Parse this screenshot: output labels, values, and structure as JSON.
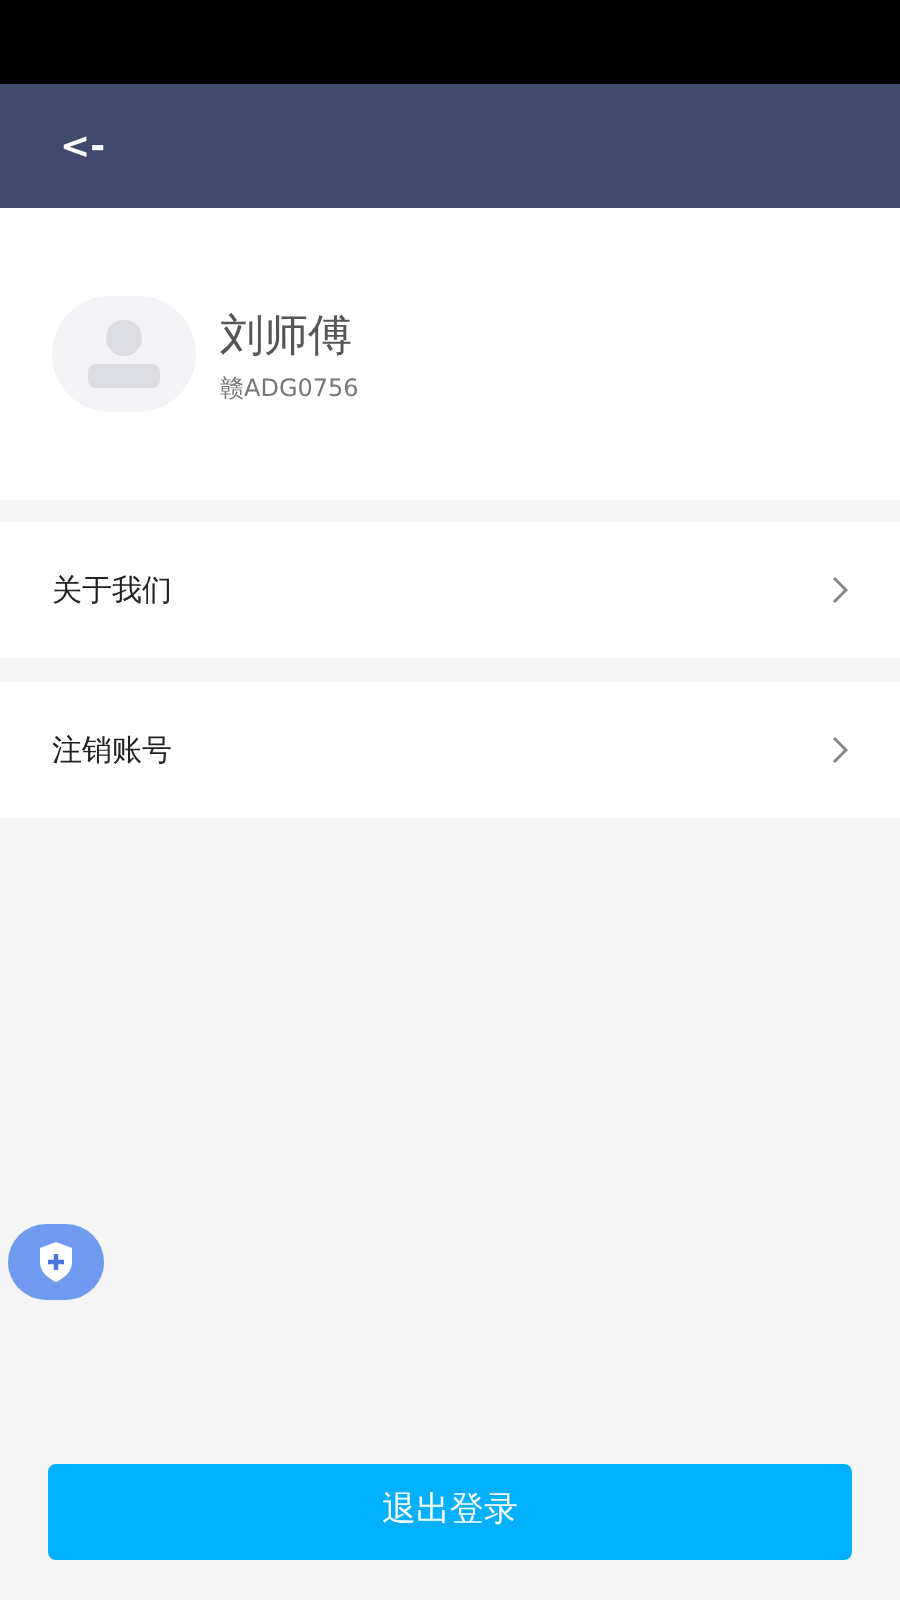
{
  "header": {
    "back": "<-"
  },
  "profile": {
    "name": "刘师傅",
    "plate": "赣ADG0756"
  },
  "menu": [
    {
      "label": "关于我们"
    },
    {
      "label": "注销账号"
    }
  ],
  "logout": "退出登录"
}
